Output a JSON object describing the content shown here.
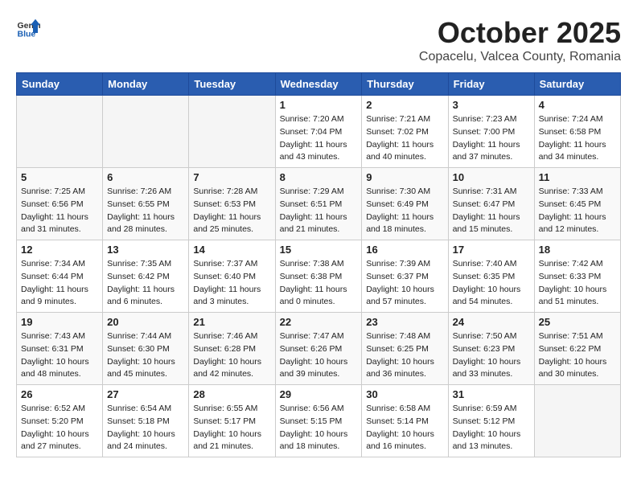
{
  "header": {
    "logo_general": "General",
    "logo_blue": "Blue",
    "month": "October 2025",
    "location": "Copacelu, Valcea County, Romania"
  },
  "weekdays": [
    "Sunday",
    "Monday",
    "Tuesday",
    "Wednesday",
    "Thursday",
    "Friday",
    "Saturday"
  ],
  "weeks": [
    [
      {
        "day": "",
        "info": ""
      },
      {
        "day": "",
        "info": ""
      },
      {
        "day": "",
        "info": ""
      },
      {
        "day": "1",
        "info": "Sunrise: 7:20 AM\nSunset: 7:04 PM\nDaylight: 11 hours\nand 43 minutes."
      },
      {
        "day": "2",
        "info": "Sunrise: 7:21 AM\nSunset: 7:02 PM\nDaylight: 11 hours\nand 40 minutes."
      },
      {
        "day": "3",
        "info": "Sunrise: 7:23 AM\nSunset: 7:00 PM\nDaylight: 11 hours\nand 37 minutes."
      },
      {
        "day": "4",
        "info": "Sunrise: 7:24 AM\nSunset: 6:58 PM\nDaylight: 11 hours\nand 34 minutes."
      }
    ],
    [
      {
        "day": "5",
        "info": "Sunrise: 7:25 AM\nSunset: 6:56 PM\nDaylight: 11 hours\nand 31 minutes."
      },
      {
        "day": "6",
        "info": "Sunrise: 7:26 AM\nSunset: 6:55 PM\nDaylight: 11 hours\nand 28 minutes."
      },
      {
        "day": "7",
        "info": "Sunrise: 7:28 AM\nSunset: 6:53 PM\nDaylight: 11 hours\nand 25 minutes."
      },
      {
        "day": "8",
        "info": "Sunrise: 7:29 AM\nSunset: 6:51 PM\nDaylight: 11 hours\nand 21 minutes."
      },
      {
        "day": "9",
        "info": "Sunrise: 7:30 AM\nSunset: 6:49 PM\nDaylight: 11 hours\nand 18 minutes."
      },
      {
        "day": "10",
        "info": "Sunrise: 7:31 AM\nSunset: 6:47 PM\nDaylight: 11 hours\nand 15 minutes."
      },
      {
        "day": "11",
        "info": "Sunrise: 7:33 AM\nSunset: 6:45 PM\nDaylight: 11 hours\nand 12 minutes."
      }
    ],
    [
      {
        "day": "12",
        "info": "Sunrise: 7:34 AM\nSunset: 6:44 PM\nDaylight: 11 hours\nand 9 minutes."
      },
      {
        "day": "13",
        "info": "Sunrise: 7:35 AM\nSunset: 6:42 PM\nDaylight: 11 hours\nand 6 minutes."
      },
      {
        "day": "14",
        "info": "Sunrise: 7:37 AM\nSunset: 6:40 PM\nDaylight: 11 hours\nand 3 minutes."
      },
      {
        "day": "15",
        "info": "Sunrise: 7:38 AM\nSunset: 6:38 PM\nDaylight: 11 hours\nand 0 minutes."
      },
      {
        "day": "16",
        "info": "Sunrise: 7:39 AM\nSunset: 6:37 PM\nDaylight: 10 hours\nand 57 minutes."
      },
      {
        "day": "17",
        "info": "Sunrise: 7:40 AM\nSunset: 6:35 PM\nDaylight: 10 hours\nand 54 minutes."
      },
      {
        "day": "18",
        "info": "Sunrise: 7:42 AM\nSunset: 6:33 PM\nDaylight: 10 hours\nand 51 minutes."
      }
    ],
    [
      {
        "day": "19",
        "info": "Sunrise: 7:43 AM\nSunset: 6:31 PM\nDaylight: 10 hours\nand 48 minutes."
      },
      {
        "day": "20",
        "info": "Sunrise: 7:44 AM\nSunset: 6:30 PM\nDaylight: 10 hours\nand 45 minutes."
      },
      {
        "day": "21",
        "info": "Sunrise: 7:46 AM\nSunset: 6:28 PM\nDaylight: 10 hours\nand 42 minutes."
      },
      {
        "day": "22",
        "info": "Sunrise: 7:47 AM\nSunset: 6:26 PM\nDaylight: 10 hours\nand 39 minutes."
      },
      {
        "day": "23",
        "info": "Sunrise: 7:48 AM\nSunset: 6:25 PM\nDaylight: 10 hours\nand 36 minutes."
      },
      {
        "day": "24",
        "info": "Sunrise: 7:50 AM\nSunset: 6:23 PM\nDaylight: 10 hours\nand 33 minutes."
      },
      {
        "day": "25",
        "info": "Sunrise: 7:51 AM\nSunset: 6:22 PM\nDaylight: 10 hours\nand 30 minutes."
      }
    ],
    [
      {
        "day": "26",
        "info": "Sunrise: 6:52 AM\nSunset: 5:20 PM\nDaylight: 10 hours\nand 27 minutes."
      },
      {
        "day": "27",
        "info": "Sunrise: 6:54 AM\nSunset: 5:18 PM\nDaylight: 10 hours\nand 24 minutes."
      },
      {
        "day": "28",
        "info": "Sunrise: 6:55 AM\nSunset: 5:17 PM\nDaylight: 10 hours\nand 21 minutes."
      },
      {
        "day": "29",
        "info": "Sunrise: 6:56 AM\nSunset: 5:15 PM\nDaylight: 10 hours\nand 18 minutes."
      },
      {
        "day": "30",
        "info": "Sunrise: 6:58 AM\nSunset: 5:14 PM\nDaylight: 10 hours\nand 16 minutes."
      },
      {
        "day": "31",
        "info": "Sunrise: 6:59 AM\nSunset: 5:12 PM\nDaylight: 10 hours\nand 13 minutes."
      },
      {
        "day": "",
        "info": ""
      }
    ]
  ]
}
